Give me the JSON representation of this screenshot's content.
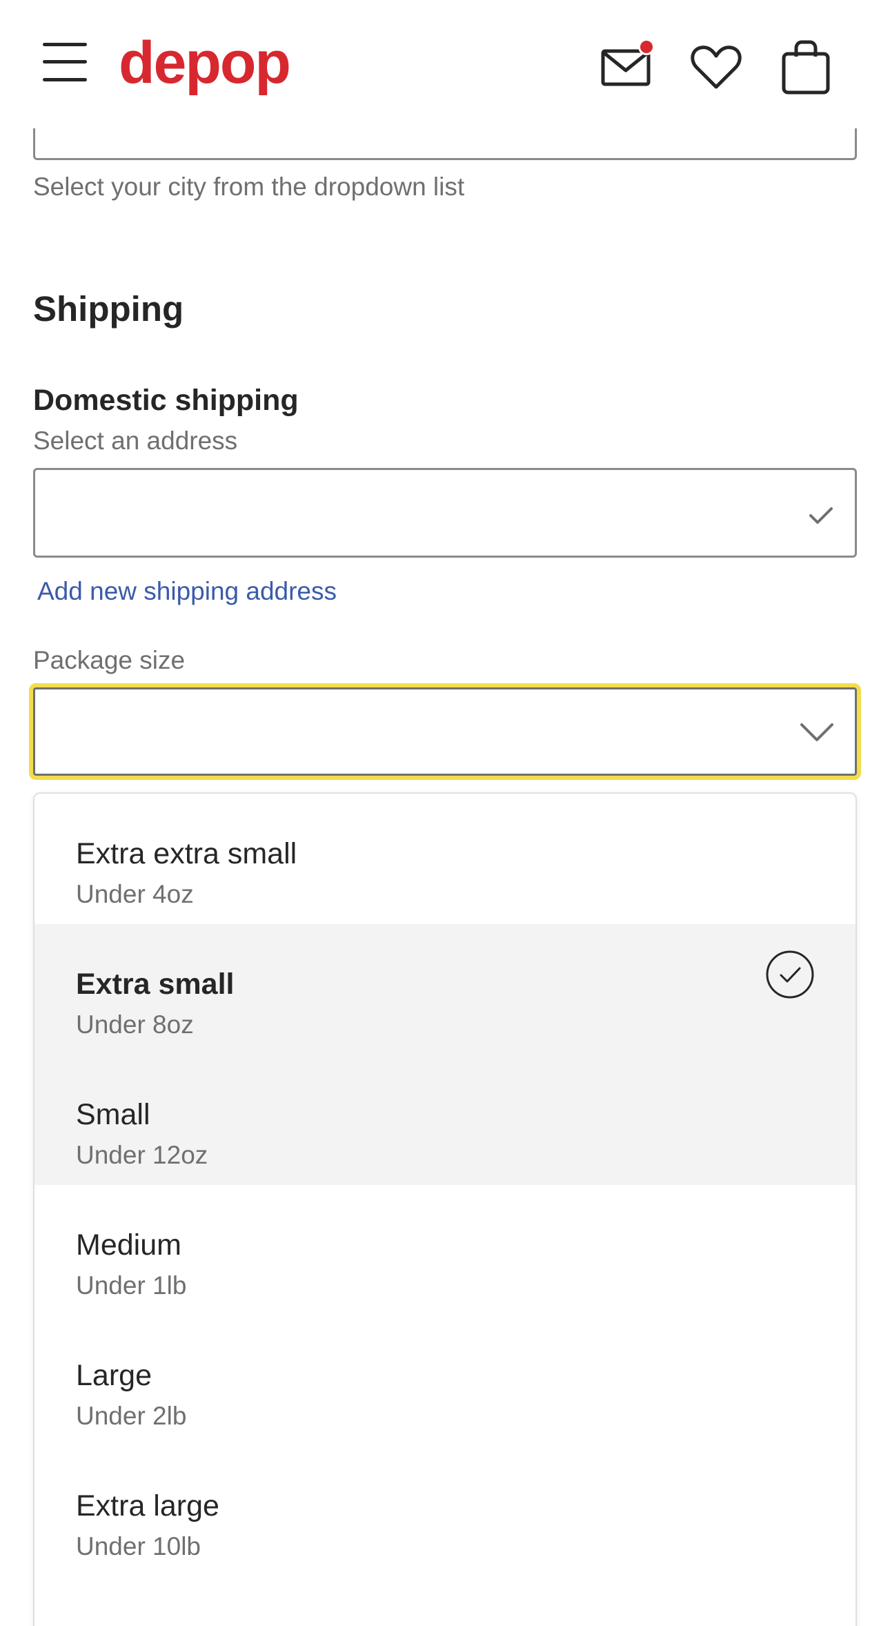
{
  "header": {
    "logo": "depop",
    "icons": [
      "menu-icon",
      "mail-icon",
      "heart-icon",
      "bag-icon"
    ]
  },
  "form": {
    "city_helper": "Select your city from the dropdown list",
    "shipping_title": "Shipping",
    "domestic_title": "Domestic shipping",
    "address_helper": "Select an address",
    "add_address_link": "Add new shipping address",
    "package_label": "Package size"
  },
  "package_options": [
    {
      "title": "Extra extra small",
      "sub": "Under 4oz"
    },
    {
      "title": "Extra small",
      "sub": "Under 8oz"
    },
    {
      "title": "Small",
      "sub": "Under 12oz"
    },
    {
      "title": "Medium",
      "sub": "Under 1lb"
    },
    {
      "title": "Large",
      "sub": "Under 2lb"
    },
    {
      "title": "Extra large",
      "sub": "Under 10lb"
    }
  ],
  "selected_option": "Extra small",
  "colors": {
    "brand": "#d7282f",
    "link": "#3b5ba9",
    "focus": "#f3dd4b"
  }
}
